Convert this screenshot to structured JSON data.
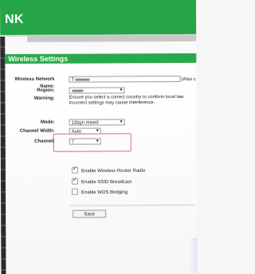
{
  "header": {
    "logo_text": "NK"
  },
  "section": {
    "title": "Wireless Settings"
  },
  "form": {
    "network_name_label": "Wireless Network Name:",
    "network_name_value_prefix": "T",
    "network_name_trailing": "(Also c",
    "region_label": "Region:",
    "region_value": "",
    "warning_label": "Warning:",
    "warning_text": "Ensure you select a correct country to conform local law. Incorrect settings may cause interference.",
    "mode_label": "Mode:",
    "mode_value": "11bgn mixed",
    "channel_width_label": "Channel Width:",
    "channel_width_value": "Auto",
    "channel_label": "Channel:",
    "channel_value": "7"
  },
  "checkboxes": [
    {
      "label": "Enable Wireless Router Radio",
      "checked": true
    },
    {
      "label": "Enable SSID Broadcast",
      "checked": true
    },
    {
      "label": "Enable WDS Bridging",
      "checked": false
    }
  ],
  "buttons": {
    "save": "Save"
  },
  "icons": {
    "dropdown": "chevron-down-icon",
    "checkbox_check": "check-icon"
  },
  "colors": {
    "brand_green": "#25a548",
    "section_green": "#2ba84b",
    "highlight_red": "#e56b6b"
  }
}
